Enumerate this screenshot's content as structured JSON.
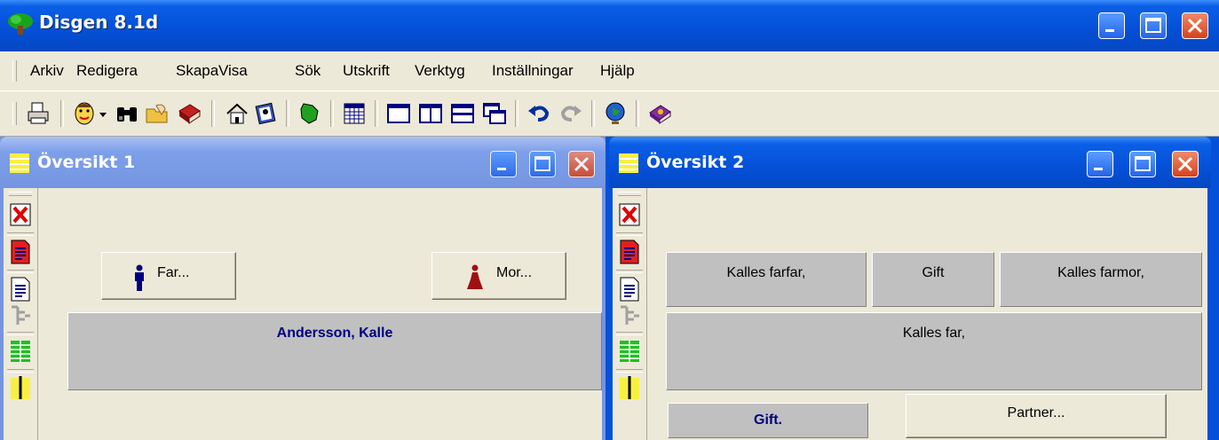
{
  "app": {
    "title": "Disgen 8.1d"
  },
  "menu": [
    {
      "label": "Arkiv"
    },
    {
      "label": "Redigera"
    },
    {
      "label": "Skapa"
    },
    {
      "label": "Visa"
    },
    {
      "label": "Sök"
    },
    {
      "label": "Utskrift"
    },
    {
      "label": "Verktyg"
    },
    {
      "label": "Inställningar"
    },
    {
      "label": "Hjälp"
    }
  ],
  "toolbar": {
    "icons": [
      "printer-icon",
      "person-face-icon",
      "dropdown-arrow-icon",
      "binoculars-icon",
      "folder-hand-icon",
      "red-book-icon",
      "home-icon",
      "address-book-icon",
      "green-map-icon",
      "calendar-grid-icon",
      "single-window-icon",
      "tile-vertical-icon",
      "tile-horizontal-icon",
      "cascade-icon",
      "undo-icon",
      "redo-icon",
      "globe-icon",
      "purple-book-icon"
    ]
  },
  "window1": {
    "title": "Översikt 1",
    "father_button": "Far...",
    "mother_button": "Mor...",
    "person_name": "Andersson, Kalle"
  },
  "window2": {
    "title": "Översikt 2",
    "grandfather": "Kalles farfar,",
    "married_grandparents": "Gift",
    "grandmother": "Kalles farmor,",
    "father": "Kalles far,",
    "married_status": "Gift.",
    "partner_button": "Partner..."
  },
  "colors": {
    "titlebar": "#0550d8",
    "inactive_title": "#7595e0",
    "face": "#ece9d8",
    "panel": "#c0c0c0",
    "name_text": "#000080"
  }
}
